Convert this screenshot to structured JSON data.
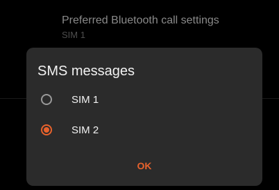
{
  "background": {
    "setting_title": "Preferred Bluetooth call settings",
    "setting_subtitle": "SIM 1"
  },
  "dialog": {
    "title": "SMS messages",
    "options": [
      {
        "label": "SIM 1",
        "selected": false
      },
      {
        "label": "SIM 2",
        "selected": true
      }
    ],
    "ok_label": "OK"
  },
  "colors": {
    "accent": "#e8622c",
    "dialog_background": "#2b2b2b",
    "screen_background": "#000000"
  },
  "icons": {
    "radio_unselected": "radio-unselected-icon",
    "radio_selected": "radio-selected-icon"
  }
}
